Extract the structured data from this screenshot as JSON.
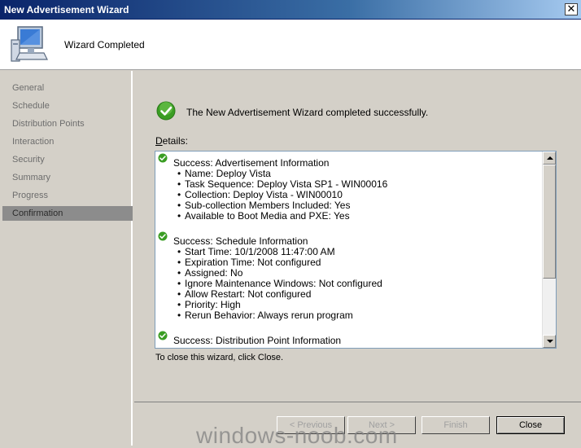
{
  "window": {
    "title": "New Advertisement Wizard",
    "close_glyph": "✕"
  },
  "header": {
    "title": "Wizard Completed"
  },
  "nav": {
    "items": [
      {
        "label": "General"
      },
      {
        "label": "Schedule"
      },
      {
        "label": "Distribution Points"
      },
      {
        "label": "Interaction"
      },
      {
        "label": "Security"
      },
      {
        "label": "Summary"
      },
      {
        "label": "Progress"
      },
      {
        "label": "Confirmation",
        "active": true
      }
    ]
  },
  "main": {
    "success_message": "The New Advertisement Wizard completed successfully.",
    "details_label_underline": "D",
    "details_label_rest": "etails:",
    "sections": [
      {
        "title": "Success: Advertisement Information",
        "items": [
          "Name: Deploy Vista",
          "Task Sequence: Deploy Vista SP1 - WIN00016",
          "Collection: Deploy Vista - WIN00010",
          "Sub-collection Members Included: Yes",
          "Available to Boot Media and PXE: Yes"
        ]
      },
      {
        "title": "Success: Schedule Information",
        "items": [
          "Start Time: 10/1/2008 11:47:00 AM",
          "Expiration Time: Not configured",
          "Assigned: No",
          "Ignore Maintenance Windows: Not configured",
          "Allow Restart: Not configured",
          "Priority: High",
          "Rerun Behavior: Always rerun program"
        ]
      },
      {
        "title": "Success: Distribution Point Information",
        "items": []
      }
    ],
    "close_hint": "To close this wizard, click Close."
  },
  "footer": {
    "previous_label": "< Previous",
    "next_label": "Next >",
    "finish_label": "Finish",
    "close_label": "Close"
  },
  "watermark": "windows-noob.com",
  "colors": {
    "accent": "#0a246a",
    "success": "#3a9d23",
    "nav_active": "#8c8c8c"
  }
}
